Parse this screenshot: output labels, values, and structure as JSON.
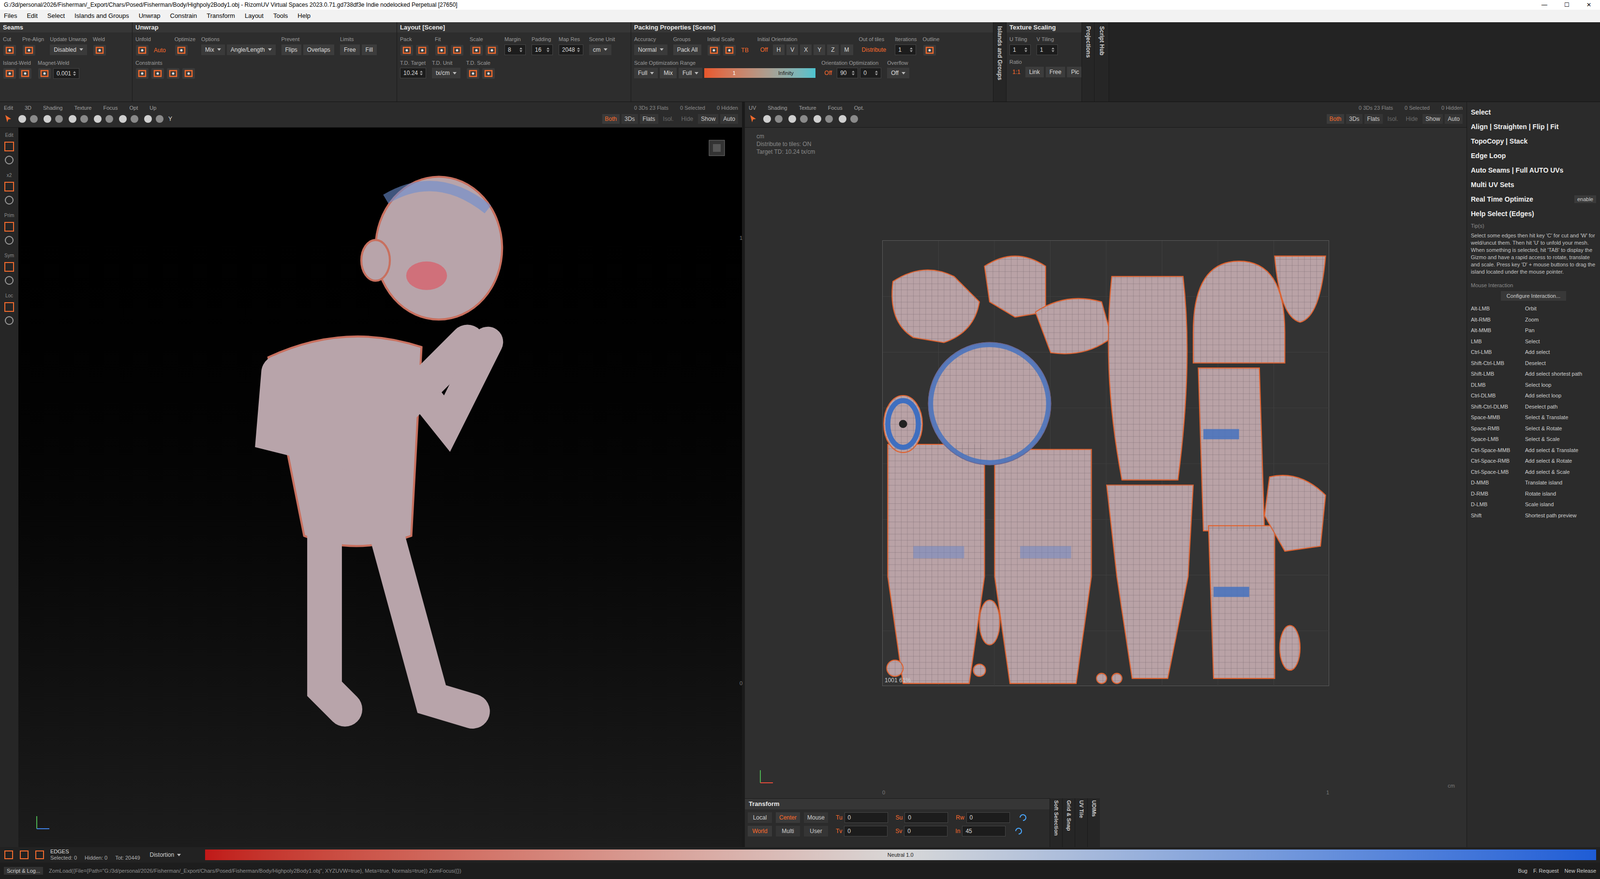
{
  "window": {
    "title": "G:/3d/personal/2026/Fisherman/_Export/Chars/Posed/Fisherman/Body/Highpoly2Body1.obj - RizomUV  Virtual Spaces 2023.0.71.gd738df3e Indie nodelocked Perpetual  [27650]",
    "controls": [
      "—",
      "☐",
      "✕"
    ]
  },
  "menu": [
    "Files",
    "Edit",
    "Select",
    "Islands and Groups",
    "Unwrap",
    "Constrain",
    "Transform",
    "Layout",
    "Tools",
    "Help"
  ],
  "panels": [
    {
      "kind": "panel",
      "title": "Seams",
      "groups": [
        {
          "label": "Cut",
          "items": [
            {
              "kind": "icon"
            }
          ]
        },
        {
          "label": "Pre-Align",
          "items": [
            {
              "kind": "icon"
            }
          ]
        },
        {
          "label": "Update Unwrap",
          "items": [
            {
              "kind": "dropdown",
              "text": "Disabled"
            }
          ]
        },
        {
          "label": "Weld",
          "items": [
            {
              "kind": "icon"
            }
          ]
        },
        {
          "label": "Island-Weld",
          "items": [
            {
              "kind": "icon"
            },
            {
              "kind": "icon"
            }
          ]
        },
        {
          "label": "Magnet-Weld",
          "items": [
            {
              "kind": "icon"
            },
            {
              "kind": "field",
              "text": "0.001"
            }
          ]
        }
      ]
    },
    {
      "kind": "panel",
      "title": "Unwrap",
      "groups": [
        {
          "label": "Unfold",
          "items": [
            {
              "kind": "icon"
            },
            {
              "kind": "accent",
              "text": "Auto"
            }
          ]
        },
        {
          "label": "Optimize",
          "items": [
            {
              "kind": "icon"
            }
          ]
        },
        {
          "label": "Options",
          "items": [
            {
              "kind": "dropdown",
              "text": "Mix"
            },
            {
              "kind": "dropdown",
              "text": "Angle/Length"
            }
          ]
        },
        {
          "label": "Prevent",
          "items": [
            {
              "kind": "button",
              "text": "Flips"
            },
            {
              "kind": "button",
              "text": "Overlaps"
            }
          ]
        },
        {
          "label": "Limits",
          "items": [
            {
              "kind": "button",
              "text": "Free"
            },
            {
              "kind": "button",
              "text": "Fill"
            }
          ]
        },
        {
          "label": "Constraints",
          "items": [
            {
              "kind": "icon"
            },
            {
              "kind": "icon"
            },
            {
              "kind": "icon"
            },
            {
              "kind": "icon"
            }
          ]
        }
      ]
    },
    {
      "kind": "panel",
      "title": "Layout [Scene]",
      "groups": [
        {
          "label": "Pack",
          "items": [
            {
              "kind": "icon"
            },
            {
              "kind": "icon"
            }
          ]
        },
        {
          "label": "Fit",
          "items": [
            {
              "kind": "icon"
            },
            {
              "kind": "icon"
            }
          ]
        },
        {
          "label": "Scale",
          "items": [
            {
              "kind": "icon"
            },
            {
              "kind": "icon"
            }
          ]
        },
        {
          "label": "Margin",
          "items": [
            {
              "kind": "field",
              "text": "8"
            }
          ]
        },
        {
          "label": "Padding",
          "items": [
            {
              "kind": "field",
              "text": "16"
            }
          ]
        },
        {
          "label": "Map Res",
          "items": [
            {
              "kind": "field",
              "text": "2048"
            }
          ]
        },
        {
          "label": "Scene Unit",
          "items": [
            {
              "kind": "dropdown",
              "text": "cm"
            }
          ]
        },
        {
          "label": "T.D. Target",
          "items": [
            {
              "kind": "field",
              "text": "10.24"
            }
          ]
        },
        {
          "label": "T.D. Unit",
          "items": [
            {
              "kind": "dropdown",
              "text": "tx/cm"
            }
          ]
        },
        {
          "label": "T.D. Scale",
          "items": [
            {
              "kind": "icon"
            },
            {
              "kind": "icon"
            }
          ]
        }
      ]
    },
    {
      "kind": "panel",
      "title": "Packing Properties [Scene]",
      "groups": [
        {
          "label": "Accuracy",
          "items": [
            {
              "kind": "dropdown",
              "text": "Normal"
            }
          ]
        },
        {
          "label": "Groups",
          "items": [
            {
              "kind": "button",
              "text": "Pack All"
            }
          ]
        },
        {
          "label": "Initial Scale",
          "items": [
            {
              "kind": "icon"
            },
            {
              "kind": "icon"
            },
            {
              "kind": "accent",
              "text": "TB"
            }
          ]
        },
        {
          "label": "Initial Orientation",
          "items": [
            {
              "kind": "accent",
              "text": "Off"
            },
            {
              "kind": "button",
              "text": "H"
            },
            {
              "kind": "button",
              "text": "V"
            },
            {
              "kind": "button",
              "text": "X"
            },
            {
              "kind": "button",
              "text": "Y"
            },
            {
              "kind": "button",
              "text": "Z"
            },
            {
              "kind": "button",
              "text": "M"
            }
          ]
        },
        {
          "label": "Out of tiles",
          "items": [
            {
              "kind": "accent",
              "text": "Distribute"
            }
          ]
        },
        {
          "label": "Iterations",
          "items": [
            {
              "kind": "field",
              "text": "1"
            }
          ]
        },
        {
          "label": "Outline",
          "items": [
            {
              "kind": "icon"
            }
          ]
        },
        {
          "label": "Scale Optimization Range",
          "items": [
            {
              "kind": "dropdown",
              "text": "Full"
            },
            {
              "kind": "button",
              "text": "Mix"
            },
            {
              "kind": "dropdown",
              "text": "Full"
            },
            {
              "kind": "range",
              "from": "1",
              "to": "Infinity"
            }
          ]
        },
        {
          "label": "Orientation Optimization",
          "items": [
            {
              "kind": "accent",
              "text": "Off"
            },
            {
              "kind": "field",
              "text": "90"
            },
            {
              "kind": "field",
              "text": "0"
            }
          ]
        },
        {
          "label": "Overflow",
          "items": [
            {
              "kind": "dropdown",
              "text": "Off"
            }
          ]
        }
      ]
    },
    {
      "kind": "vertical",
      "title": "Islands and Groups",
      "groups": []
    },
    {
      "kind": "panel",
      "title": "Texture Scaling",
      "groups": [
        {
          "label": "U Tiling",
          "items": [
            {
              "kind": "field",
              "text": "1"
            }
          ]
        },
        {
          "label": "V Tiling",
          "items": [
            {
              "kind": "field",
              "text": "1"
            }
          ]
        },
        {
          "label": "Ratio",
          "items": [
            {
              "kind": "accent",
              "text": "1:1"
            },
            {
              "kind": "button",
              "text": "Link"
            },
            {
              "kind": "button",
              "text": "Free"
            },
            {
              "kind": "button",
              "text": "Pic"
            }
          ]
        }
      ]
    },
    {
      "kind": "vertical",
      "title": "Projections",
      "groups": []
    },
    {
      "kind": "vertical",
      "title": "Script Hub",
      "groups": []
    }
  ],
  "viewports": [
    {
      "label": "Edit",
      "groups": [
        "3D",
        "Shading",
        "Texture",
        "Focus",
        "Opt",
        "Up"
      ],
      "axis": "Y",
      "stats": [
        "0 3Ds 23 Flats",
        "0 Selected",
        "0 Hidden"
      ],
      "buttons": [
        {
          "text": "Both",
          "selected": true,
          "disabled": false
        },
        {
          "text": "3Ds",
          "selected": false,
          "disabled": false
        },
        {
          "text": "Flats",
          "selected": false,
          "disabled": false
        },
        {
          "text": "Isol.",
          "selected": false,
          "disabled": true
        },
        {
          "text": "Hide",
          "selected": false,
          "disabled": true
        },
        {
          "text": "Show",
          "selected": false,
          "disabled": false
        },
        {
          "text": "Auto",
          "selected": false,
          "disabled": false
        }
      ]
    },
    {
      "label": "UV",
      "groups": [
        "Shading",
        "Texture",
        "Focus",
        "Opt."
      ],
      "axis": "",
      "stats": [
        "0 3Ds 23 Flats",
        "0 Selected",
        "0 Hidden"
      ],
      "buttons": [
        {
          "text": "Both",
          "selected": true,
          "disabled": false
        },
        {
          "text": "3Ds",
          "selected": false,
          "disabled": false
        },
        {
          "text": "Flats",
          "selected": false,
          "disabled": false
        },
        {
          "text": "Isol.",
          "selected": false,
          "disabled": true
        },
        {
          "text": "Hide",
          "selected": false,
          "disabled": true
        },
        {
          "text": "Show",
          "selected": false,
          "disabled": false
        },
        {
          "text": "Auto",
          "selected": false,
          "disabled": false
        }
      ]
    }
  ],
  "left_toolbar": [
    "Edit",
    "x2",
    "Prim",
    "Sym",
    "Loc"
  ],
  "uv_view": {
    "overlay": [
      "cm",
      "Distribute to tiles: ON",
      "Target TD: 10.24 tx/cm"
    ],
    "axis": {
      "top": "1",
      "left_bottom": "0",
      "bottom_left": "0",
      "bottom_right": "1",
      "unit": "cm"
    },
    "tile": {
      "label": "1001  61%"
    }
  },
  "transform": {
    "title": "Transform",
    "rows": [
      {
        "modes": [
          {
            "text": "Local",
            "selected": false
          },
          {
            "text": "Center",
            "selected": true
          },
          {
            "text": "Mouse",
            "selected": false
          }
        ],
        "fields": [
          {
            "label": "Tu",
            "value": "0"
          },
          {
            "label": "Su",
            "value": "0"
          },
          {
            "label": "Rw",
            "value": "0"
          }
        ]
      },
      {
        "modes": [
          {
            "text": "World",
            "selected": true
          },
          {
            "text": "Multi",
            "selected": false
          },
          {
            "text": "User",
            "selected": false
          }
        ],
        "fields": [
          {
            "label": "Tv",
            "value": "0"
          },
          {
            "label": "Sv",
            "value": "0"
          },
          {
            "label": "In",
            "value": "45"
          }
        ]
      }
    ],
    "side_tabs": [
      "Soft Selection",
      "Grid & Snap",
      "UV Tile",
      "UDIMs"
    ]
  },
  "right_panel": {
    "sections": [
      {
        "title": "Select",
        "button": ""
      },
      {
        "title": "Align | Straighten | Flip | Fit",
        "button": ""
      },
      {
        "title": "TopoCopy | Stack",
        "button": ""
      },
      {
        "title": "Edge Loop",
        "button": ""
      },
      {
        "title": "Auto Seams | Full AUTO UVs",
        "button": ""
      },
      {
        "title": "Multi UV Sets",
        "button": ""
      },
      {
        "title": "Real Time Optimize",
        "button": "enable"
      },
      {
        "title": "Help Select (Edges)",
        "button": ""
      }
    ],
    "tips_label": "Tip(s)",
    "tip": "Select some edges then hit key 'C' for cut and 'W' for weld/uncut them. Then hit 'U' to unfold your mesh. When something is selected, hit 'TAB' to display the Gizmo and have a rapid access to rotate, translate and scale. Press key 'D' + mouse buttons to drag the island located under the mouse pointer.",
    "mouse_label": "Mouse Interaction",
    "configure": "Configure Interaction...",
    "keys": [
      [
        "Alt-LMB",
        "Orbit"
      ],
      [
        "Alt-RMB",
        "Zoom"
      ],
      [
        "Alt-MMB",
        "Pan"
      ],
      [
        "LMB",
        "Select"
      ],
      [
        "Ctrl-LMB",
        "Add select"
      ],
      [
        "Shift-Ctrl-LMB",
        "Deselect"
      ],
      [
        "Shift-LMB",
        "Add select shortest path"
      ],
      [
        "DLMB",
        "Select loop"
      ],
      [
        "Ctrl-DLMB",
        "Add select loop"
      ],
      [
        "Shift-Ctrl-DLMB",
        "Deselect path"
      ],
      [
        "Space-MMB",
        "Select & Translate"
      ],
      [
        "Space-RMB",
        "Select & Rotate"
      ],
      [
        "Space-LMB",
        "Select & Scale"
      ],
      [
        "Ctrl-Space-MMB",
        "Add select & Translate"
      ],
      [
        "Ctrl-Space-RMB",
        "Add select & Rotate"
      ],
      [
        "Ctrl-Space-LMB",
        "Add select & Scale"
      ],
      [
        "D-MMB",
        "Translate island"
      ],
      [
        "D-RMB",
        "Rotate island"
      ],
      [
        "D-LMB",
        "Scale island"
      ],
      [
        "Shift",
        "Shortest path preview"
      ]
    ]
  },
  "status": {
    "mode": "EDGES",
    "counts": [
      "Selected: 0",
      "Hidden: 0",
      "Tot: 20449"
    ],
    "metric": "Distortion",
    "neutral": "Neutral 1.0"
  },
  "bottom": {
    "script": "Script & Log...",
    "log": "ZomLoad({File={Path=\"G:/3d/personal/2026/Fisherman/_Export/Chars/Posed/Fisherman/Body/Highpoly2Body1.obj\", XYZUVW=true}, Meta=true, Normals=true}) ZomFocus({})",
    "links": [
      "Bug",
      "F. Request",
      "New Release"
    ]
  }
}
